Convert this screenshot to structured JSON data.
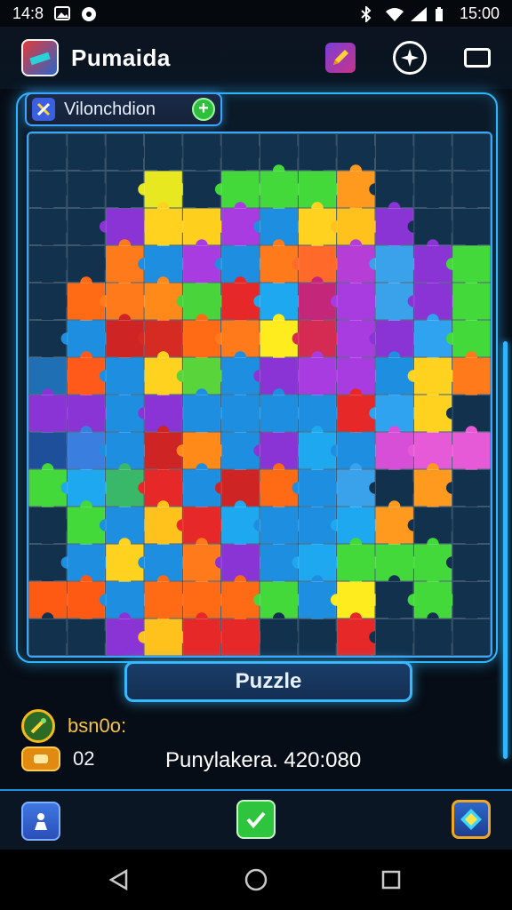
{
  "status": {
    "time_left": "14:8",
    "time_right": "15:00"
  },
  "app": {
    "title": "Pumaida"
  },
  "board": {
    "chip_label": "Vilonchdion",
    "rows": [
      [
        "#12314d",
        "#12314d",
        "#12314d",
        "#12314d",
        "#12314d",
        "#12314d",
        "#12314d",
        "#12314d",
        "#12314d",
        "#12314d",
        "#12314d",
        "#12314d"
      ],
      [
        "#12314d",
        "#12314d",
        "#12314d",
        "#e7e820",
        "#12314d",
        "#43d93a",
        "#43d93a",
        "#43d93a",
        "#ff9a1f",
        "#12314d",
        "#12314d",
        "#12314d"
      ],
      [
        "#12314d",
        "#12314d",
        "#8a34d6",
        "#ffd21f",
        "#ffcf1e",
        "#a93ce0",
        "#1e8fe0",
        "#ffd21f",
        "#ffc21c",
        "#8a34d6",
        "#12314d",
        "#12314d"
      ],
      [
        "#12314d",
        "#12314d",
        "#ff7a1a",
        "#1e8fe0",
        "#a93ce0",
        "#1e8fe0",
        "#ff7a1a",
        "#ff6a2a",
        "#b63dd6",
        "#3aa2ea",
        "#8a34d6",
        "#43d93a"
      ],
      [
        "#12314d",
        "#ff6a14",
        "#ff7a1a",
        "#ff8a1a",
        "#49d43c",
        "#e62828",
        "#1ea8f0",
        "#c4267a",
        "#a93ce0",
        "#3aa2ea",
        "#8a34d6",
        "#43d93a"
      ],
      [
        "#12314d",
        "#1e8fe0",
        "#cf2424",
        "#d62b22",
        "#ff6a14",
        "#ff7a1a",
        "#ffec1e",
        "#d52b52",
        "#a93ce0",
        "#8a34d6",
        "#2fa3ef",
        "#43d93a"
      ],
      [
        "#1e6fb4",
        "#ff5a1a",
        "#1e8fe0",
        "#ffd21f",
        "#59d43a",
        "#1e8fe0",
        "#8a34d6",
        "#a93ce0",
        "#a93ce0",
        "#1e8fe0",
        "#ffd21f",
        "#ff7a1a"
      ],
      [
        "#8a34d6",
        "#8a34d6",
        "#1e8fe0",
        "#8a34d6",
        "#1e8fe0",
        "#1e8fe0",
        "#1e8fe0",
        "#1e8fe0",
        "#e62828",
        "#2fa3ef",
        "#ffd21f",
        "#12314d"
      ],
      [
        "#1e4f9a",
        "#3a7ee0",
        "#1e8fe0",
        "#cf2424",
        "#ff8a1a",
        "#1e8fe0",
        "#8a34d6",
        "#1ea8f0",
        "#1e8fe0",
        "#d64fd6",
        "#e65ad8",
        "#e65ad8"
      ],
      [
        "#43d93a",
        "#1ea8f0",
        "#3ab86a",
        "#e62828",
        "#1e8fe0",
        "#cf2424",
        "#ff6a14",
        "#1e8fe0",
        "#3aa2ea",
        "#12314d",
        "#ff9a1f",
        "#12314d"
      ],
      [
        "#12314d",
        "#43d93a",
        "#1e8fe0",
        "#ffc21c",
        "#e62828",
        "#1ea8f0",
        "#1e8fe0",
        "#1e8fe0",
        "#1ea8f0",
        "#ff9a1f",
        "#12314d",
        "#12314d"
      ],
      [
        "#12314d",
        "#1e8fe0",
        "#ffd21f",
        "#1e8fe0",
        "#ff7a1a",
        "#8a34d6",
        "#1e8fe0",
        "#1ea8f0",
        "#43d93a",
        "#43d93a",
        "#43d93a",
        "#12314d"
      ],
      [
        "#ff5a14",
        "#ff5a14",
        "#1e8fe0",
        "#ff6a14",
        "#ff6a14",
        "#ff6a14",
        "#43d93a",
        "#1e8fe0",
        "#ffec1e",
        "#12314d",
        "#43d93a",
        "#12314d"
      ],
      [
        "#12314d",
        "#12314d",
        "#8a34d6",
        "#ffc21c",
        "#e62828",
        "#e62828",
        "#12314d",
        "#12314d",
        "#e62828",
        "#12314d",
        "#12314d",
        "#12314d"
      ]
    ]
  },
  "actions": {
    "puzzle_label": "Puzzle"
  },
  "info": {
    "label": "bsn0o:",
    "count": "02",
    "score": "Punylakera. 420:080"
  },
  "colors": {
    "accent": "#2fb6ff",
    "gold": "#f2c348"
  },
  "icons": {
    "status": [
      "gallery-icon",
      "record-icon",
      "bluetooth-icon",
      "wifi-icon",
      "signal-icon",
      "battery-icon"
    ],
    "bottom": [
      "person-icon",
      "check-icon",
      "diamond-icon"
    ],
    "nav": [
      "back-icon",
      "home-icon",
      "recent-icon"
    ]
  }
}
